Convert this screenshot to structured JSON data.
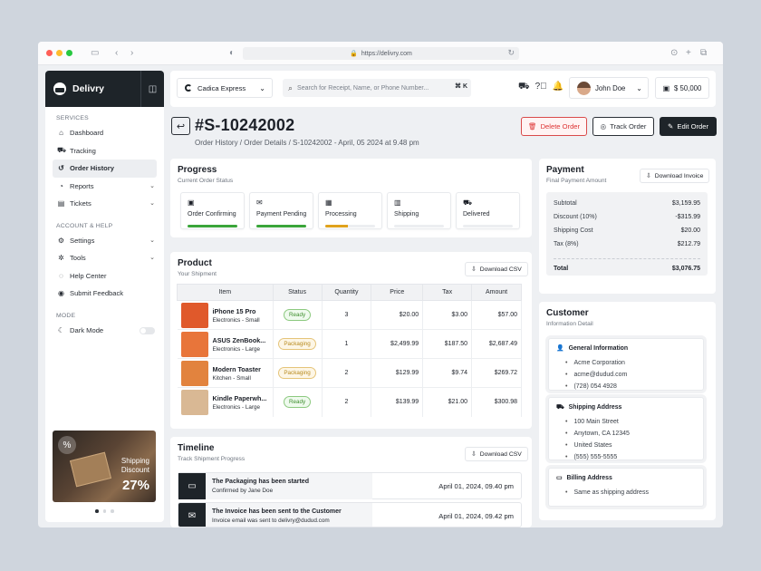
{
  "browser": {
    "url": "https://delivry.com"
  },
  "sidebar": {
    "brand": "Delivry",
    "sections": {
      "services": "SERVICES",
      "account": "ACCOUNT & HELP",
      "mode": "MODE"
    },
    "items": [
      {
        "label": "Dashboard",
        "icon": "home-icon"
      },
      {
        "label": "Tracking",
        "icon": "truck-icon"
      },
      {
        "label": "Order History",
        "icon": "history-icon"
      },
      {
        "label": "Reports",
        "icon": "chart-icon"
      },
      {
        "label": "Tickets",
        "icon": "ticket-icon"
      }
    ],
    "account_items": [
      {
        "label": "Settings",
        "icon": "gear-icon"
      },
      {
        "label": "Tools",
        "icon": "tools-icon"
      },
      {
        "label": "Help Center",
        "icon": "help-icon"
      },
      {
        "label": "Submit Feedback",
        "icon": "feedback-icon"
      }
    ],
    "dark_mode_label": "Dark Mode",
    "promo": {
      "line1": "Shipping",
      "line2": "Discount",
      "value": "27%"
    }
  },
  "topbar": {
    "company": "Cadica Express",
    "search_placeholder": "Search for Receipt, Name, or Phone Number...",
    "shortcut": "⌘ K",
    "user": "John Doe",
    "balance": "$ 50,000"
  },
  "header": {
    "order_id": "#S-10242002",
    "breadcrumb": "Order History / Order Details / S-10242002 - April, 05 2024 at 9.48 pm",
    "delete_label": "Delete Order",
    "track_label": "Track Order",
    "edit_label": "Edit Order"
  },
  "progress": {
    "title": "Progress",
    "subtitle": "Current Order Status",
    "steps": [
      {
        "label": "Order Confirming",
        "fill": 1.0,
        "color": "#3aa53a"
      },
      {
        "label": "Payment Pending",
        "fill": 1.0,
        "color": "#3aa53a"
      },
      {
        "label": "Processing",
        "fill": 0.45,
        "color": "#e0a21c"
      },
      {
        "label": "Shipping",
        "fill": 0,
        "color": "#3aa53a"
      },
      {
        "label": "Delivered",
        "fill": 0,
        "color": "#3aa53a"
      }
    ]
  },
  "product": {
    "title": "Product",
    "subtitle": "Your Shipment",
    "download": "Download CSV",
    "columns": [
      "Item",
      "Status",
      "Quantity",
      "Price",
      "Tax",
      "Amount"
    ],
    "rows": [
      {
        "name": "iPhone 15 Pro",
        "cat": "Electronics - Small",
        "status": "Ready",
        "qty": "3",
        "price": "$20.00",
        "tax": "$3.00",
        "amount": "$57.00",
        "color": "#e0592b"
      },
      {
        "name": "ASUS ZenBook...",
        "cat": "Electronics - Large",
        "status": "Packaging",
        "qty": "1",
        "price": "$2,499.99",
        "tax": "$187.50",
        "amount": "$2,687.49",
        "color": "#e8753a"
      },
      {
        "name": "Modern Toaster",
        "cat": "Kitchen - Small",
        "status": "Packaging",
        "qty": "2",
        "price": "$129.99",
        "tax": "$9.74",
        "amount": "$269.72",
        "color": "#e2833e"
      },
      {
        "name": "Kindle Paperwh...",
        "cat": "Electronics - Large",
        "status": "Ready",
        "qty": "2",
        "price": "$139.99",
        "tax": "$21.00",
        "amount": "$300.98",
        "color": "#d9b894"
      }
    ]
  },
  "timeline": {
    "title": "Timeline",
    "subtitle": "Track Shipment Progress",
    "download": "Download CSV",
    "events": [
      {
        "title": "The Packaging has been started",
        "sub": "Confirmed by Jane Doe",
        "date": "April 01, 2024, 09.40 pm"
      },
      {
        "title": "The Invoice has been sent to the Customer",
        "sub": "Invoice email was sent to delivry@dudud.com",
        "date": "April 01, 2024, 09.42 pm"
      }
    ]
  },
  "payment": {
    "title": "Payment",
    "subtitle": "Final Payment Amount",
    "download": "Download Invoice",
    "lines": [
      {
        "label": "Subtotal",
        "value": "$3,159.95"
      },
      {
        "label": "Discount (10%)",
        "value": "-$315.99"
      },
      {
        "label": "Shipping Cost",
        "value": "$20.00"
      },
      {
        "label": "Tax (8%)",
        "value": "$212.79"
      }
    ],
    "total_label": "Total",
    "total_value": "$3,076.75"
  },
  "customer": {
    "title": "Customer",
    "subtitle": "Information Detail",
    "general": {
      "title": "General Information",
      "items": [
        "Acme Corporation",
        "acme@dudud.com",
        "(728) 054 4928"
      ]
    },
    "shipping": {
      "title": "Shipping Address",
      "items": [
        "100 Main Street",
        "Anytown, CA 12345",
        "United States",
        "(555) 555-5555"
      ]
    },
    "billing": {
      "title": "Billing Address",
      "items": [
        "Same as shipping address"
      ]
    }
  }
}
